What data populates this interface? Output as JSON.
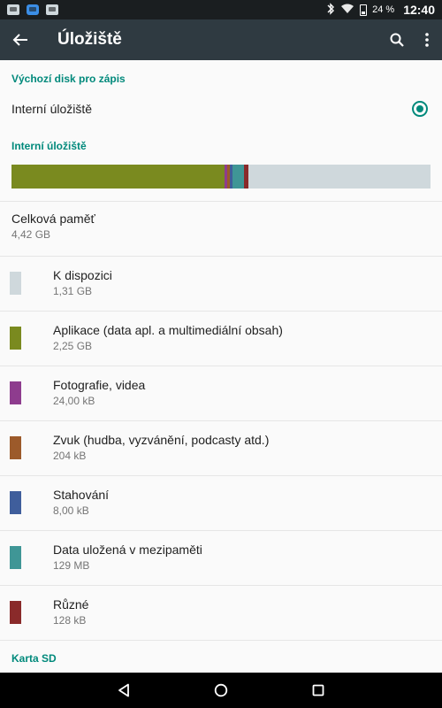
{
  "status_bar": {
    "battery_percent": "24 %",
    "time": "12:40",
    "icons": [
      "gmail-icon",
      "app-icon",
      "gallery-icon",
      "bluetooth-icon",
      "wifi-icon",
      "battery-icon"
    ]
  },
  "app_bar": {
    "title": "Úložiště"
  },
  "default_disk": {
    "header": "Výchozí disk pro zápis",
    "option_label": "Interní úložiště",
    "selected": true
  },
  "internal": {
    "header": "Interní úložiště",
    "usage_bar": [
      {
        "name": "Aplikace",
        "fraction": 0.509,
        "color": "#7a8a1f"
      },
      {
        "name": "Fotografie",
        "fraction": 0.006,
        "color": "#8e3c8e"
      },
      {
        "name": "Zvuk",
        "fraction": 0.006,
        "color": "#9c5a2a"
      },
      {
        "name": "Stahování",
        "fraction": 0.006,
        "color": "#3f5e9c"
      },
      {
        "name": "Mezipaměť",
        "fraction": 0.028,
        "color": "#3f9696"
      },
      {
        "name": "Různé",
        "fraction": 0.01,
        "color": "#8a2a2a"
      }
    ],
    "free_color": "#cfd8dc",
    "total": {
      "title": "Celková paměť",
      "value": "4,42 GB"
    },
    "categories": [
      {
        "title": "K dispozici",
        "value": "1,31 GB",
        "color": "#cfd8dc"
      },
      {
        "title": "Aplikace (data apl. a multimediální obsah)",
        "value": "2,25 GB",
        "color": "#7a8a1f"
      },
      {
        "title": "Fotografie, videa",
        "value": "24,00 kB",
        "color": "#8e3c8e"
      },
      {
        "title": "Zvuk (hudba, vyzvánění, podcasty atd.)",
        "value": "204 kB",
        "color": "#9c5a2a"
      },
      {
        "title": "Stahování",
        "value": "8,00 kB",
        "color": "#3f5e9c"
      },
      {
        "title": "Data uložená v mezipaměti",
        "value": "129 MB",
        "color": "#3f9696"
      },
      {
        "title": "Různé",
        "value": "128 kB",
        "color": "#8a2a2a"
      }
    ]
  },
  "sd_card": {
    "header": "Karta SD"
  },
  "colors": {
    "accent": "#00897b",
    "app_bar": "#2f3a41",
    "status_bar": "#1a1e20"
  }
}
